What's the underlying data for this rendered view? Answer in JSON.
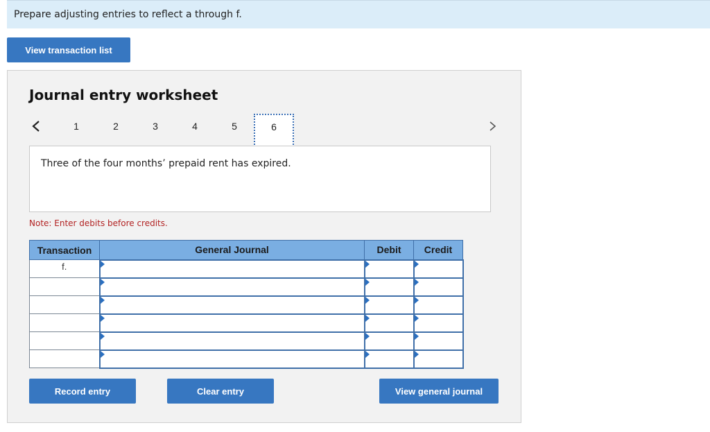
{
  "instruction": "Prepare adjusting entries to reflect a through f.",
  "buttons": {
    "view_transaction_list": "View transaction list",
    "record_entry": "Record entry",
    "clear_entry": "Clear entry",
    "view_general_journal": "View general journal"
  },
  "worksheet": {
    "title": "Journal entry worksheet",
    "pages": [
      "1",
      "2",
      "3",
      "4",
      "5",
      "6"
    ],
    "active_page": "6",
    "description": "Three of the four months’ prepaid rent has expired.",
    "note": "Note: Enter debits before credits."
  },
  "table": {
    "headers": [
      "Transaction",
      "General Journal",
      "Debit",
      "Credit"
    ],
    "rows": [
      {
        "transaction": "f.",
        "account": "",
        "debit": "",
        "credit": ""
      },
      {
        "transaction": "",
        "account": "",
        "debit": "",
        "credit": ""
      },
      {
        "transaction": "",
        "account": "",
        "debit": "",
        "credit": ""
      },
      {
        "transaction": "",
        "account": "",
        "debit": "",
        "credit": ""
      },
      {
        "transaction": "",
        "account": "",
        "debit": "",
        "credit": ""
      },
      {
        "transaction": "",
        "account": "",
        "debit": "",
        "credit": ""
      }
    ]
  },
  "icons": {
    "prev": "chevron-left-icon",
    "next": "chevron-right-icon",
    "field_marker": "triangle-marker-icon"
  },
  "colors": {
    "button_blue": "#3777c1",
    "header_blue": "#7aaee2",
    "instruction_bg": "#dbedf9",
    "note_red": "#b22222"
  }
}
